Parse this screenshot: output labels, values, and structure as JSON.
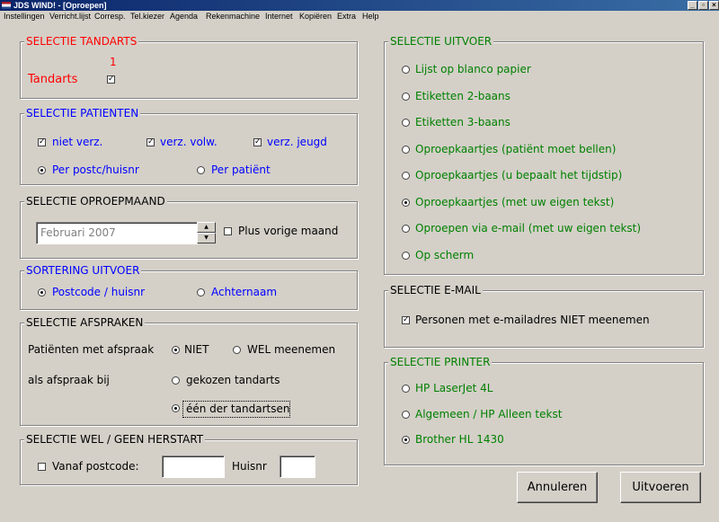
{
  "window": {
    "title": "JDS WIND!  - [Oproepen]",
    "controls": {
      "minimize": "_",
      "restore": "▫",
      "close": "×"
    }
  },
  "menu": [
    "Instellingen",
    "Verricht.lijst",
    "Corresp.",
    "Tel.kiezer",
    "Agenda",
    "Rekenmachine",
    "Internet",
    "Kopiëren",
    "Extra",
    "Help"
  ],
  "tandarts": {
    "title": "SELECTIE TANDARTS",
    "number": "1",
    "label": "Tandarts",
    "checked": true
  },
  "patienten": {
    "title": "SELECTIE PATIENTEN",
    "checks": [
      {
        "label": "niet verz.",
        "checked": true
      },
      {
        "label": "verz. volw.",
        "checked": true
      },
      {
        "label": "verz. jeugd",
        "checked": true
      }
    ],
    "radios": [
      {
        "label": "Per postc/huisnr",
        "selected": true
      },
      {
        "label": "Per patiënt",
        "selected": false
      }
    ]
  },
  "oproepmaand": {
    "title": "SELECTIE OPROEPMAAND",
    "value": "Februari 2007",
    "plus_label": "Plus vorige maand",
    "plus_checked": false
  },
  "sortering": {
    "title": "SORTERING UITVOER",
    "radios": [
      {
        "label": "Postcode / huisnr",
        "selected": true
      },
      {
        "label": "Achternaam",
        "selected": false
      }
    ]
  },
  "afspraken": {
    "title": "SELECTIE AFSPRAKEN",
    "row1_label": "Patiënten met afspraak",
    "row1_radios": [
      {
        "label": "NIET",
        "selected": true
      },
      {
        "label": "WEL meenemen",
        "selected": false
      }
    ],
    "row2_label": "als afspraak bij",
    "row2_radios": [
      {
        "label": "gekozen tandarts",
        "selected": false
      },
      {
        "label": "één der tandartsen",
        "selected": true
      }
    ]
  },
  "herstart": {
    "title": "SELECTIE WEL / GEEN HERSTART",
    "check_label": "Vanaf postcode:",
    "checked": false,
    "postcode_value": "",
    "huisnr_label": "Huisnr",
    "huisnr_value": ""
  },
  "uitvoer": {
    "title": "SELECTIE UITVOER",
    "options": [
      {
        "label": "Lijst op blanco papier",
        "selected": false
      },
      {
        "label": "Etiketten 2-baans",
        "selected": false
      },
      {
        "label": "Etiketten 3-baans",
        "selected": false
      },
      {
        "label": "Oproepkaartjes (patiënt moet bellen)",
        "selected": false
      },
      {
        "label": "Oproepkaartjes (u bepaalt het tijdstip)",
        "selected": false
      },
      {
        "label": "Oproepkaartjes (met uw eigen tekst)",
        "selected": true
      },
      {
        "label": "Oproepen via e-mail (met uw eigen tekst)",
        "selected": false
      },
      {
        "label": "Op scherm",
        "selected": false
      }
    ]
  },
  "email": {
    "title": "SELECTIE E-MAIL",
    "check_label": "Personen met e-mailadres NIET meenemen",
    "checked": true
  },
  "printer": {
    "title": "SELECTIE PRINTER",
    "options": [
      {
        "label": "HP LaserJet 4L",
        "selected": false
      },
      {
        "label": "Algemeen / HP Alleen tekst",
        "selected": false
      },
      {
        "label": "Brother HL 1430",
        "selected": true
      }
    ]
  },
  "buttons": {
    "cancel": "Annuleren",
    "run": "Uitvoeren"
  },
  "colors": {
    "red_titles": "#ff0000",
    "blue_text": "#0000ff",
    "green_text": "#008000",
    "title_bar": "#0a246a",
    "dialog_bg": "#d4d0c8"
  }
}
